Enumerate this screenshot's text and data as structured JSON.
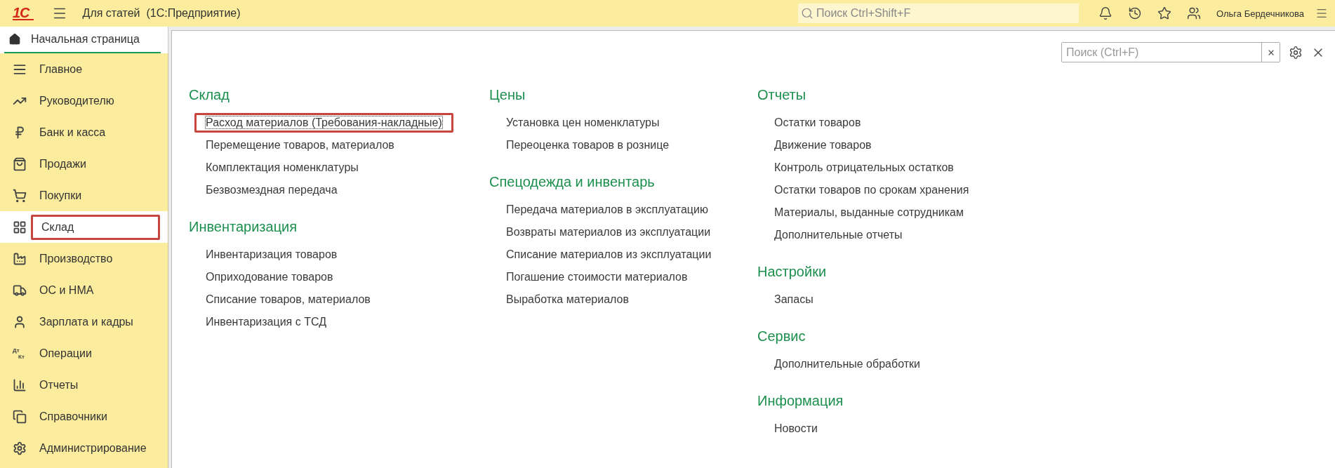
{
  "app": {
    "logo": "1С",
    "title": "Для статей  (1С:Предприятие)",
    "search_placeholder": "Поиск Ctrl+Shift+F",
    "user": "Ольга Бердечникова"
  },
  "tabs": [
    {
      "label": "Начальная страница",
      "selected": true
    }
  ],
  "sidebar": {
    "items": [
      {
        "label": "Главное",
        "selected": false,
        "highlighted": false
      },
      {
        "label": "Руководителю",
        "selected": false,
        "highlighted": false
      },
      {
        "label": "Банк и касса",
        "selected": false,
        "highlighted": false
      },
      {
        "label": "Продажи",
        "selected": false,
        "highlighted": false
      },
      {
        "label": "Покупки",
        "selected": false,
        "highlighted": false
      },
      {
        "label": "Склад",
        "selected": true,
        "highlighted": true
      },
      {
        "label": "Производство",
        "selected": false,
        "highlighted": false
      },
      {
        "label": "ОС и НМА",
        "selected": false,
        "highlighted": false
      },
      {
        "label": "Зарплата и кадры",
        "selected": false,
        "highlighted": false
      },
      {
        "label": "Операции",
        "icon_text": [
          "Дт",
          "Кт"
        ],
        "selected": false,
        "highlighted": false
      },
      {
        "label": "Отчеты",
        "selected": false,
        "highlighted": false
      },
      {
        "label": "Справочники",
        "selected": false,
        "highlighted": false
      },
      {
        "label": "Администрирование",
        "selected": false,
        "highlighted": false
      }
    ]
  },
  "panel": {
    "search_placeholder": "Поиск (Ctrl+F)",
    "columns": [
      [
        {
          "title": "Склад",
          "items": [
            {
              "label": "Расход материалов (Требования-накладные)",
              "focused": true,
              "highlighted": true
            },
            {
              "label": "Перемещение товаров, материалов",
              "focused": false,
              "highlighted": false
            },
            {
              "label": "Комплектация номенклатуры",
              "focused": false,
              "highlighted": false
            },
            {
              "label": "Безвозмездная передача",
              "focused": false,
              "highlighted": false
            }
          ]
        },
        {
          "title": "Инвентаризация",
          "items": [
            {
              "label": "Инвентаризация товаров",
              "focused": false,
              "highlighted": false
            },
            {
              "label": "Оприходование товаров",
              "focused": false,
              "highlighted": false
            },
            {
              "label": "Списание товаров, материалов",
              "focused": false,
              "highlighted": false
            },
            {
              "label": "Инвентаризация с ТСД",
              "focused": false,
              "highlighted": false
            }
          ]
        }
      ],
      [
        {
          "title": "Цены",
          "items": [
            {
              "label": "Установка цен номенклатуры",
              "focused": false,
              "highlighted": false
            },
            {
              "label": "Переоценка товаров в рознице",
              "focused": false,
              "highlighted": false
            }
          ]
        },
        {
          "title": "Спецодежда и инвентарь",
          "items": [
            {
              "label": "Передача материалов в эксплуатацию",
              "focused": false,
              "highlighted": false
            },
            {
              "label": "Возвраты материалов из эксплуатации",
              "focused": false,
              "highlighted": false
            },
            {
              "label": "Списание материалов из эксплуатации",
              "focused": false,
              "highlighted": false
            },
            {
              "label": "Погашение стоимости материалов",
              "focused": false,
              "highlighted": false
            },
            {
              "label": "Выработка материалов",
              "focused": false,
              "highlighted": false
            }
          ]
        }
      ],
      [
        {
          "title": "Отчеты",
          "items": [
            {
              "label": "Остатки товаров",
              "focused": false,
              "highlighted": false
            },
            {
              "label": "Движение товаров",
              "focused": false,
              "highlighted": false
            },
            {
              "label": "Контроль отрицательных остатков",
              "focused": false,
              "highlighted": false
            },
            {
              "label": "Остатки товаров по срокам хранения",
              "focused": false,
              "highlighted": false
            },
            {
              "label": "Материалы, выданные сотрудникам",
              "focused": false,
              "highlighted": false
            },
            {
              "label": "Дополнительные отчеты",
              "focused": false,
              "highlighted": false
            }
          ]
        },
        {
          "title": "Настройки",
          "items": [
            {
              "label": "Запасы",
              "focused": false,
              "highlighted": false
            }
          ]
        },
        {
          "title": "Сервис",
          "items": [
            {
              "label": "Дополнительные обработки",
              "focused": false,
              "highlighted": false
            }
          ]
        },
        {
          "title": "Информация",
          "items": [
            {
              "label": "Новости",
              "focused": false,
              "highlighted": false
            }
          ]
        }
      ]
    ]
  }
}
